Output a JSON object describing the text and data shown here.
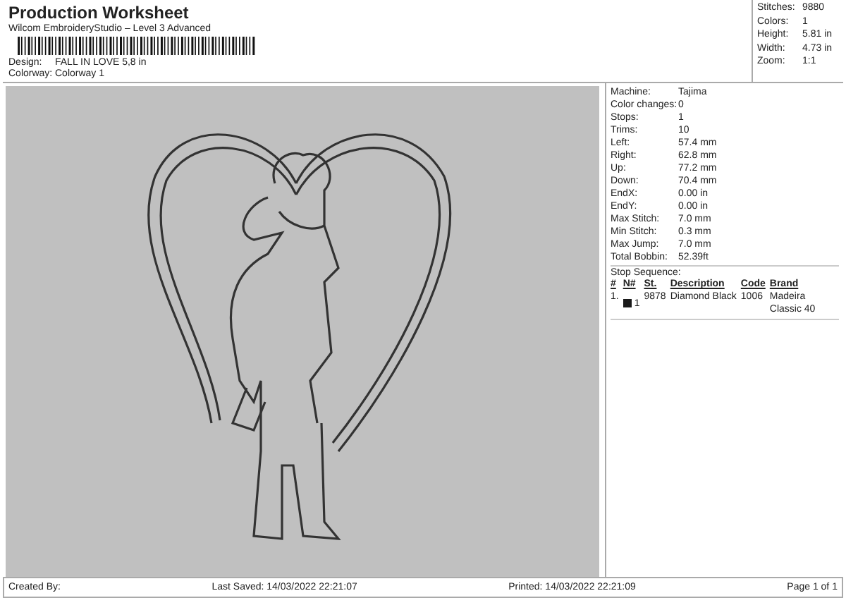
{
  "header": {
    "title": "Production Worksheet",
    "subtitle": "Wilcom EmbroideryStudio – Level 3 Advanced",
    "fields": [
      {
        "label": "Design:",
        "value": "FALL IN LOVE 5,8 in"
      },
      {
        "label": "Colorway:",
        "value": "Colorway 1"
      }
    ]
  },
  "summary": [
    {
      "label": "Stitches:",
      "value": "9880"
    },
    {
      "label": "Colors:",
      "value": "1"
    },
    {
      "label": "Height:",
      "value": "5.81 in"
    },
    {
      "label": "Width:",
      "value": "4.73 in"
    },
    {
      "label": "Zoom:",
      "value": "1:1"
    }
  ],
  "details": [
    {
      "label": "Machine:",
      "value": "Tajima"
    },
    {
      "label": "Color changes:",
      "value": "0"
    },
    {
      "label": "Stops:",
      "value": "1"
    },
    {
      "label": "Trims:",
      "value": "10"
    },
    {
      "label": "Left:",
      "value": "57.4 mm"
    },
    {
      "label": "Right:",
      "value": "62.8 mm"
    },
    {
      "label": "Up:",
      "value": "77.2 mm"
    },
    {
      "label": "Down:",
      "value": "70.4 mm"
    },
    {
      "label": "EndX:",
      "value": "0.00 in"
    },
    {
      "label": "EndY:",
      "value": "0.00 in"
    },
    {
      "label": "Max Stitch:",
      "value": "7.0 mm"
    },
    {
      "label": "Min Stitch:",
      "value": "0.3 mm"
    },
    {
      "label": "Max Jump:",
      "value": "7.0 mm"
    },
    {
      "label": "Total Bobbin:",
      "value": "52.39ft"
    }
  ],
  "stop_sequence": {
    "title": "Stop Sequence:",
    "columns": [
      "#",
      "N#",
      "St.",
      "Description",
      "Code",
      "Brand"
    ],
    "rows": [
      {
        "cells": [
          "1.",
          "1",
          "9878",
          "Diamond Black",
          "1006",
          "Madeira Classic 40"
        ],
        "color": "#1a1a1a"
      }
    ]
  },
  "footer": {
    "created": "Created By:",
    "saved": "Last Saved: 14/03/2022 22:21:07",
    "printed": "Printed: 14/03/2022 22:21:09",
    "page": "Page 1 of 1"
  }
}
